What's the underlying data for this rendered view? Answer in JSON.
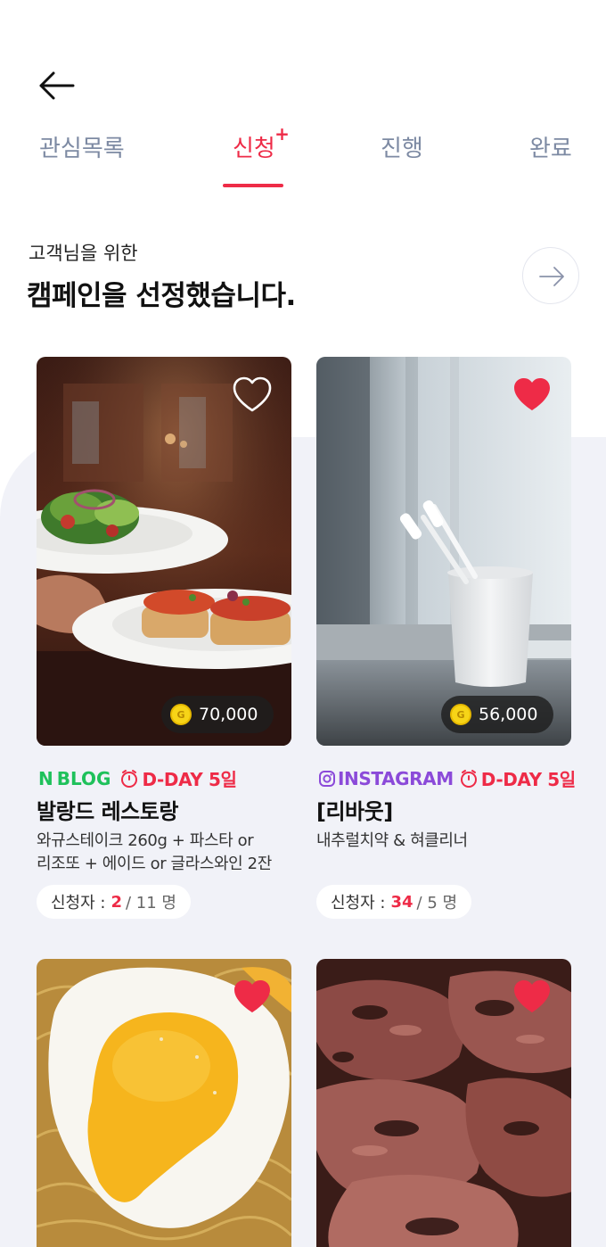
{
  "header": {
    "back_icon": "arrow-left-icon"
  },
  "tabs": [
    {
      "label": "관심목록",
      "active": false
    },
    {
      "label": "신청",
      "active": true,
      "badge": "+"
    },
    {
      "label": "진행",
      "active": false
    },
    {
      "label": "완료",
      "active": false
    }
  ],
  "section": {
    "subtitle": "고객님을 위한",
    "title": "캠페인을 선정했습니다.",
    "next_icon": "arrow-right-icon"
  },
  "colors": {
    "accent": "#ee2b47",
    "blog": "#1fc15b",
    "instagram": "#8b4ad9",
    "tab_inactive": "#7d8aa3",
    "panel_bg": "#f1f2f8"
  },
  "campaigns": [
    {
      "image": "salad-and-bruschetta-plates",
      "liked": false,
      "reward": "70,000",
      "coin_label": "G",
      "channel": "BLOG",
      "channel_icon": "naver-n-icon",
      "dday": "D-DAY 5일",
      "title": "발랑드 레스토랑",
      "desc_line1": "와규스테이크 260g + 파스타 or",
      "desc_line2": "리조또 + 에이드 or 글라스와인 2잔",
      "applicants_label": "신청자 :",
      "applicants_current": "2",
      "applicants_total": "/ 11 명"
    },
    {
      "image": "toothbrushes-in-cup",
      "liked": true,
      "reward": "56,000",
      "coin_label": "G",
      "channel": "INSTAGRAM",
      "channel_icon": "instagram-icon",
      "dday": "D-DAY 5일",
      "title": "[리바웃]",
      "desc_line1": "내추럴치약 & 혀클리너",
      "desc_line2": "",
      "applicants_label": "신청자 :",
      "applicants_current": "34",
      "applicants_total": "/ 5 명"
    },
    {
      "image": "fried-egg-on-noodles",
      "liked": true
    },
    {
      "image": "grilled-meat",
      "liked": true
    }
  ]
}
